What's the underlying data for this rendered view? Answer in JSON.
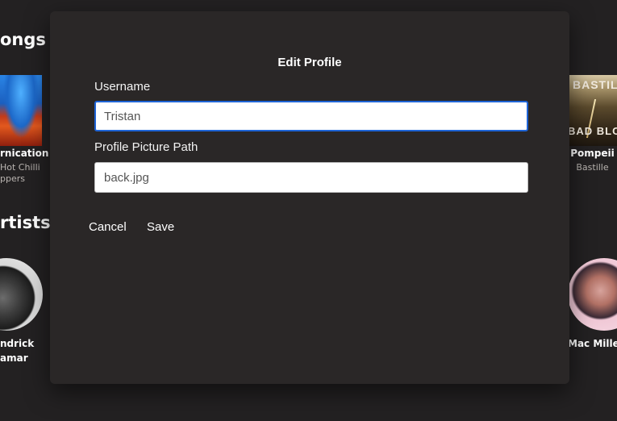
{
  "background": {
    "songs_heading": "ongs",
    "artists_heading": "rtists",
    "songs": [
      {
        "title": "rnication",
        "artist_line1": "Hot Chilli",
        "artist_line2": "ppers"
      },
      {
        "title": "Pompeii",
        "artist": "Bastille",
        "art_text_top": "BASTILLE",
        "art_text_bottom": "BAD BLOOD"
      }
    ],
    "artists": [
      {
        "line1": "ndrick",
        "line2": "amar"
      },
      {
        "name": "Mac Miller"
      }
    ]
  },
  "modal": {
    "title": "Edit Profile",
    "username_label": "Username",
    "username_value": "Tristan",
    "picture_label": "Profile Picture Path",
    "picture_value": "back.jpg",
    "cancel_label": "Cancel",
    "save_label": "Save"
  },
  "colors": {
    "page_background": "#232122",
    "modal_background": "#2a2727",
    "focus_border": "#1f64d6"
  }
}
